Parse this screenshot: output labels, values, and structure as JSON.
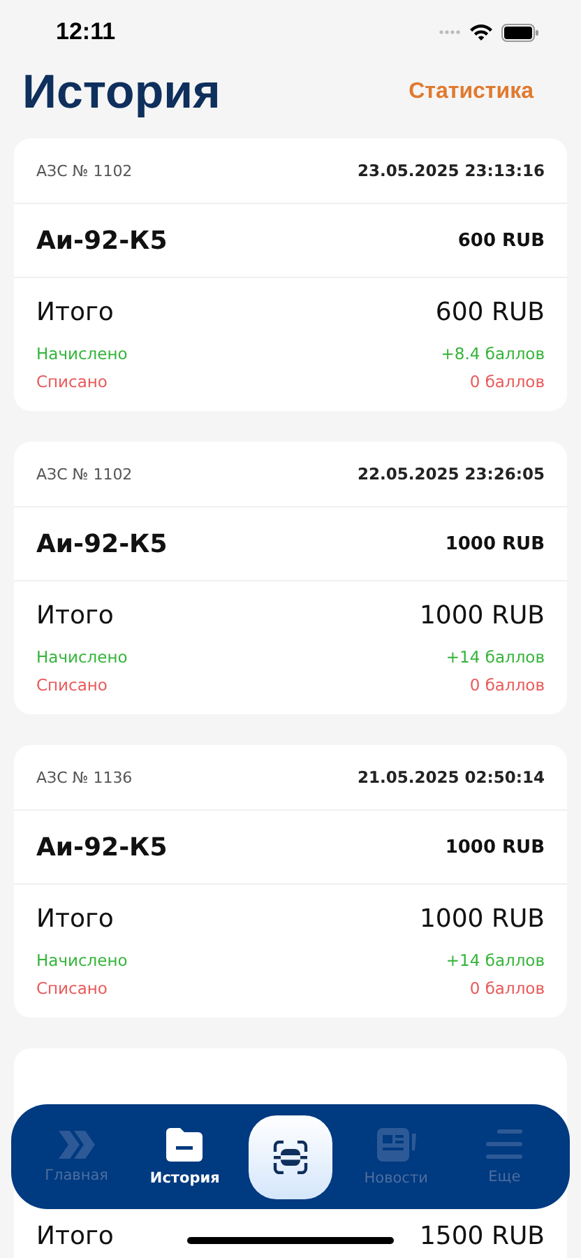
{
  "status_bar": {
    "time": "12:11"
  },
  "header": {
    "title": "История",
    "action": "Статистика"
  },
  "transactions": [
    {
      "kind": "full",
      "station": "АЗС № 1102",
      "datetime": "23.05.2025 23:13:16",
      "product": "Аи-92-К5",
      "product_amount": "600 RUB",
      "total_label": "Итого",
      "total": "600 RUB",
      "accrued_label": "Начислено",
      "accrued": "+8.4 баллов",
      "debited_label": "Списано",
      "debited": "0 баллов"
    },
    {
      "kind": "full",
      "station": "АЗС № 1102",
      "datetime": "22.05.2025 23:26:05",
      "product": "Аи-92-К5",
      "product_amount": "1000 RUB",
      "total_label": "Итого",
      "total": "1000 RUB",
      "accrued_label": "Начислено",
      "accrued": "+14 баллов",
      "debited_label": "Списано",
      "debited": "0 баллов"
    },
    {
      "kind": "full",
      "station": "АЗС № 1136",
      "datetime": "21.05.2025 02:50:14",
      "product": "Аи-92-К5",
      "product_amount": "1000 RUB",
      "total_label": "Итого",
      "total": "1000 RUB",
      "accrued_label": "Начислено",
      "accrued": "+14 баллов",
      "debited_label": "Списано",
      "debited": "0 баллов"
    },
    {
      "kind": "partial",
      "total_label": "Итого",
      "total": "1500 RUB"
    }
  ],
  "tab_bar": {
    "items": [
      {
        "kind": "home",
        "label": "Главная",
        "selected": false
      },
      {
        "kind": "history",
        "label": "История",
        "selected": true
      },
      {
        "kind": "scan",
        "selected": false
      },
      {
        "kind": "news",
        "label": "Новости",
        "selected": false
      },
      {
        "kind": "more",
        "label": "Еще",
        "selected": false
      }
    ]
  }
}
